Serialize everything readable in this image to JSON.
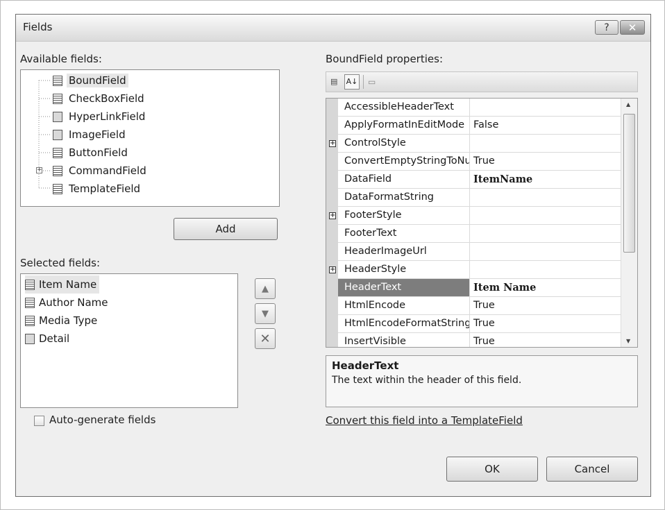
{
  "window": {
    "title": "Fields",
    "help_glyph": "?",
    "close_glyph": "✕"
  },
  "available": {
    "label": "Available fields:",
    "items": [
      {
        "label": "BoundField",
        "icon": "boundfield-icon"
      },
      {
        "label": "CheckBoxField",
        "icon": "checkboxfield-icon"
      },
      {
        "label": "HyperLinkField",
        "icon": "hyperlinkfield-icon"
      },
      {
        "label": "ImageField",
        "icon": "imagefield-icon"
      },
      {
        "label": "ButtonField",
        "icon": "buttonfield-icon"
      },
      {
        "label": "CommandField",
        "icon": "commandfield-icon"
      },
      {
        "label": "TemplateField",
        "icon": "templatefield-icon"
      }
    ]
  },
  "add_button": "Add",
  "selected": {
    "label": "Selected fields:",
    "items": [
      {
        "label": "Item Name"
      },
      {
        "label": "Author Name"
      },
      {
        "label": "Media Type"
      },
      {
        "label": "Detail"
      }
    ]
  },
  "autogen_label": "Auto-generate fields",
  "properties": {
    "label": "BoundField properties:",
    "rows": [
      {
        "name": "AccessibleHeaderText",
        "value": ""
      },
      {
        "name": "ApplyFormatInEditMode",
        "value": "False"
      },
      {
        "name": "ControlStyle",
        "value": ""
      },
      {
        "name": "ConvertEmptyStringToNull",
        "value": "True"
      },
      {
        "name": "DataField",
        "value": "ItemName"
      },
      {
        "name": "DataFormatString",
        "value": ""
      },
      {
        "name": "FooterStyle",
        "value": ""
      },
      {
        "name": "FooterText",
        "value": ""
      },
      {
        "name": "HeaderImageUrl",
        "value": ""
      },
      {
        "name": "HeaderStyle",
        "value": ""
      },
      {
        "name": "HeaderText",
        "value": "Item Name"
      },
      {
        "name": "HtmlEncode",
        "value": "True"
      },
      {
        "name": "HtmlEncodeFormatString",
        "value": "True"
      },
      {
        "name": "InsertVisible",
        "value": "True"
      }
    ]
  },
  "description": {
    "title": "HeaderText",
    "text": "The text within the header of this field."
  },
  "convert_link": "Convert this field into a TemplateField",
  "ok_button": "OK",
  "cancel_button": "Cancel"
}
